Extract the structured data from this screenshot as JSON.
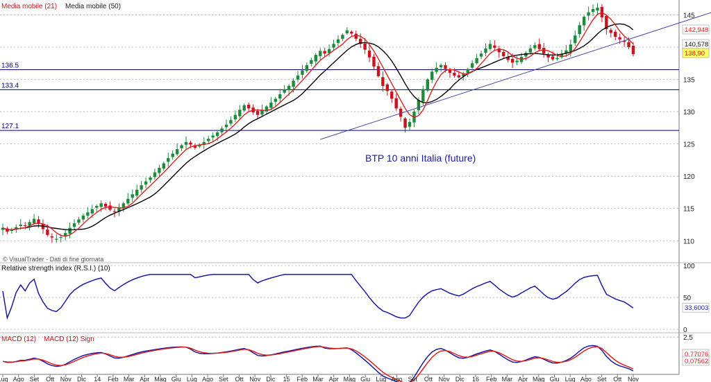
{
  "legend": {
    "ma21_label": "Media mobile (21)",
    "ma50_label": "Media mobile (50)"
  },
  "watermark": "© VisualTrader - Dati di fine giornata",
  "chart_title": "BTP 10 anni Italia (future)",
  "colors": {
    "up_candle": "#1e8a3c",
    "down_candle": "#c8141e",
    "ma21": "#dd2020",
    "ma50": "#000000",
    "rsi_line": "#1a1aa0",
    "macd_line": "#1a1aa0",
    "macd_signal": "#dd2020",
    "hline": "#000080",
    "trendline": "#4a4aa8",
    "grid": "#a8a8a8",
    "value_box_bg": "#ffff66",
    "title_color": "#1a1aa0"
  },
  "chart_data": [
    {
      "type": "candlestick",
      "name": "price",
      "x_ticks": [
        "Lug",
        "Ago",
        "Set",
        "Ott",
        "Nov",
        "Dic",
        "14",
        "Feb",
        "Mar",
        "Apr",
        "Mag",
        "Giu",
        "Lug",
        "Ago",
        "Set",
        "Ott",
        "Nov",
        "Dic",
        "15",
        "Feb",
        "Mar",
        "Apr",
        "Mag",
        "Giu",
        "Lug",
        "Ago",
        "Set",
        "Ott",
        "Nov",
        "Dic",
        "16",
        "Feb",
        "Mar",
        "Apr",
        "Mag",
        "Giu",
        "Lug",
        "Ago",
        "Set",
        "Ott",
        "Nov"
      ],
      "y_ticks": [
        110,
        115,
        120,
        125,
        130,
        135,
        140,
        145
      ],
      "ylim": [
        106.7,
        147.3
      ],
      "horizontal_levels": [
        {
          "label": "136.5",
          "value": 136.5
        },
        {
          "label": "133.4",
          "value": 133.4
        },
        {
          "label": "127.1",
          "value": 127.1
        }
      ],
      "trendline": {
        "from": {
          "x": "Lug 2015",
          "y": 125.7
        },
        "to": {
          "x": "Nov 2016",
          "y": 143.2
        }
      },
      "value_labels": [
        {
          "label": "142,948",
          "series": "Media mobile (21)",
          "value": 142.948
        },
        {
          "label": "140,578",
          "series": "Media mobile (50)",
          "value": 140.578
        },
        {
          "label": "138,90",
          "series": "price",
          "value": 138.9
        }
      ],
      "closes": [
        112.0,
        111.4,
        111.7,
        112.1,
        112.5,
        112.3,
        112.9,
        113.4,
        112.6,
        111.8,
        110.9,
        110.5,
        110.3,
        110.6,
        111.2,
        112.0,
        112.7,
        113.3,
        113.9,
        114.4,
        114.9,
        115.4,
        115.8,
        115.3,
        114.8,
        114.5,
        115.1,
        115.8,
        116.5,
        117.2,
        117.9,
        118.6,
        119.2,
        119.8,
        120.6,
        121.3,
        122.0,
        122.8,
        123.5,
        124.2,
        124.8,
        125.3,
        124.9,
        124.4,
        124.8,
        125.3,
        125.8,
        126.3,
        126.8,
        127.4,
        128.0,
        128.7,
        129.5,
        130.3,
        131.0,
        130.5,
        129.9,
        129.5,
        130.2,
        130.8,
        131.4,
        132.0,
        132.7,
        133.4,
        134.0,
        134.8,
        135.6,
        136.4,
        137.2,
        138.0,
        138.8,
        139.4,
        139.0,
        139.7,
        140.5,
        141.2,
        141.9,
        142.6,
        142.1,
        141.3,
        140.5,
        139.6,
        138.4,
        137.0,
        135.5,
        134.0,
        133.2,
        132.0,
        130.5,
        129.2,
        127.5,
        128.4,
        130.0,
        131.8,
        133.5,
        135.0,
        136.2,
        136.8,
        137.2,
        136.6,
        136.0,
        135.6,
        135.3,
        135.8,
        136.6,
        137.5,
        138.3,
        139.0,
        139.8,
        140.5,
        139.9,
        139.2,
        138.6,
        138.0,
        137.6,
        137.9,
        138.5,
        139.1,
        139.8,
        140.3,
        139.7,
        139.0,
        138.4,
        138.1,
        138.3,
        138.9,
        139.5,
        140.4,
        141.8,
        143.4,
        144.7,
        145.4,
        145.9,
        146.1,
        144.6,
        142.8,
        142.2,
        141.6,
        141.2,
        140.8,
        140.0,
        138.9
      ]
    },
    {
      "type": "line",
      "name": "Relative strength index (R.S.I.) (10)",
      "title": "Relative strength index (R.S.I.) (10)",
      "y_ticks": [
        0,
        50,
        100
      ],
      "ylim": [
        -2,
        100
      ],
      "last_value_label": "33,6003",
      "last_value": 33.6
    },
    {
      "type": "line",
      "name": "MACD",
      "series_names": [
        "MACD (12)",
        "MACD (12) Sign"
      ],
      "y_ticks": [
        2.5
      ],
      "ylim": [
        -1.2,
        2.8
      ],
      "last_value_labels": [
        "0,77076",
        "0,07562"
      ]
    }
  ]
}
